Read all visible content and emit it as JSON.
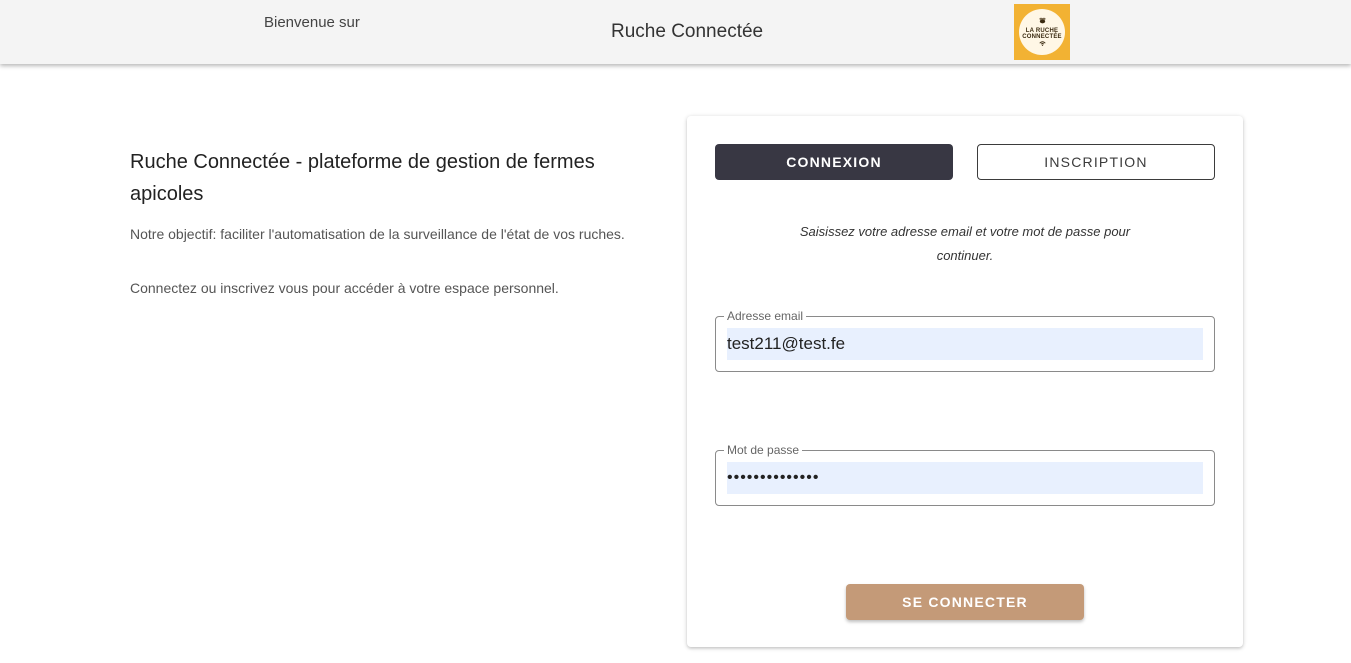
{
  "header": {
    "welcome": "Bienvenue sur",
    "title": "Ruche Connectée",
    "logo": {
      "line1": "LA RUCHE",
      "line2": "CONNECTÉE",
      "bee_icon": "bee-icon",
      "wifi_icon": "wifi-icon",
      "background_color": "#f2b233"
    }
  },
  "intro": {
    "title": "Ruche Connectée - plateforme de gestion de fermes apicoles",
    "objective": "Notre objectif: faciliter l'automatisation de la surveillance de l'état de vos ruches.",
    "cta": "Connectez ou inscrivez vous pour accéder à votre espace personnel."
  },
  "auth": {
    "tabs": {
      "login": "CONNEXION",
      "signup": "INSCRIPTION",
      "active": "login"
    },
    "instructions": "Saisissez votre adresse email et votre mot de passe pour continuer.",
    "email": {
      "label": "Adresse email",
      "value": "test211@test.fe"
    },
    "password": {
      "label": "Mot de passe",
      "value": "••••••••••••••"
    },
    "submit": "SE CONNECTER"
  },
  "colors": {
    "active_tab": "#383743",
    "submit_button": "#c49a78",
    "autofill_background": "#e8f0fe",
    "header_background": "#f4f4f4"
  }
}
